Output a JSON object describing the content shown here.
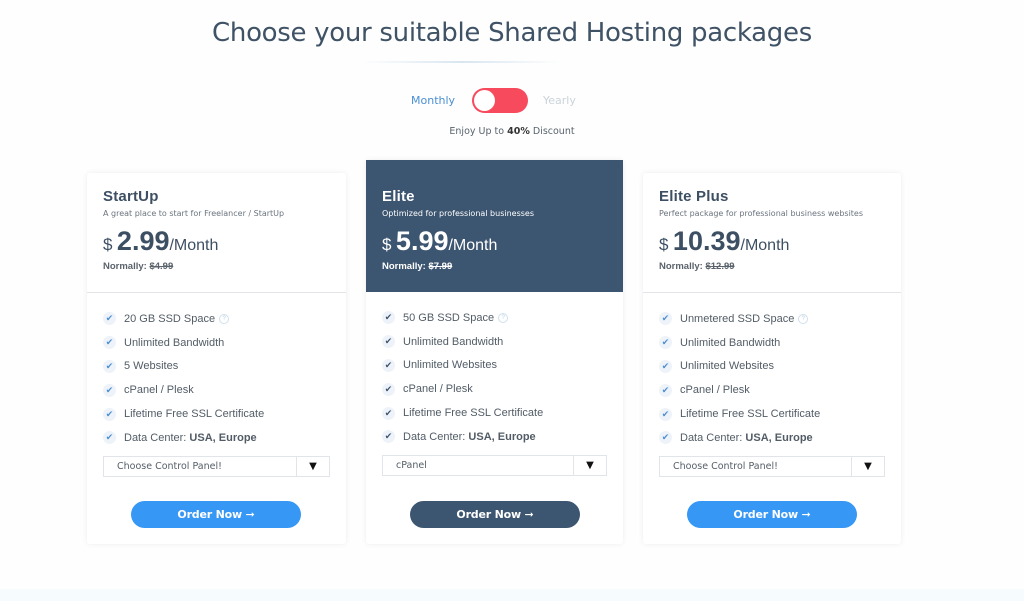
{
  "header": {
    "title": "Choose your suitable Shared Hosting packages",
    "billing_toggle": {
      "monthly_label": "Monthly",
      "yearly_label": "Yearly",
      "selected": "Monthly"
    },
    "discount_prefix": "Enjoy Up to ",
    "discount_value": "40%",
    "discount_suffix": " Discount"
  },
  "plans": [
    {
      "name": "StartUp",
      "description": "A great place to start for Freelancer / StartUp",
      "currency": "$",
      "price": "2.99",
      "period": "/Month",
      "normally_label": "Normally:",
      "normally_price": "$4.99",
      "features": [
        "20 GB SSD Space",
        "Unlimited Bandwidth",
        "5 Websites",
        "cPanel / Plesk",
        "Lifetime Free SSL Certificate",
        "Data Center: "
      ],
      "data_center": "USA, Europe",
      "control_panel": "Choose Control Panel!",
      "order_label": "Order Now ➞"
    },
    {
      "name": "Elite",
      "description": "Optimized for professional businesses",
      "currency": "$",
      "price": "5.99",
      "period": "/Month",
      "normally_label": "Normally:",
      "normally_price": "$7.99",
      "features": [
        "50 GB SSD Space",
        "Unlimited Bandwidth",
        "Unlimited Websites",
        "cPanel / Plesk",
        "Lifetime Free SSL Certificate",
        "Data Center: "
      ],
      "data_center": "USA, Europe",
      "control_panel": "cPanel",
      "order_label": "Order Now ➞"
    },
    {
      "name": "Elite Plus",
      "description": "Perfect package for professional business websites",
      "currency": "$",
      "price": "10.39",
      "period": "/Month",
      "normally_label": "Normally:",
      "normally_price": "$12.99",
      "features": [
        "Unmetered SSD Space",
        "Unlimited Bandwidth",
        "Unlimited Websites",
        "cPanel / Plesk",
        "Lifetime Free SSL Certificate",
        "Data Center: "
      ],
      "data_center": "USA, Europe",
      "control_panel": "Choose Control Panel!",
      "order_label": "Order Now ➞"
    }
  ],
  "icons": {
    "check": "✔",
    "help": "?",
    "dropdown": "▼"
  },
  "colors": {
    "accent_blue": "#3797f5",
    "featured_navy": "#3c5570",
    "toggle_red": "#f74a5c",
    "monthly_blue": "#4b8fd3"
  }
}
